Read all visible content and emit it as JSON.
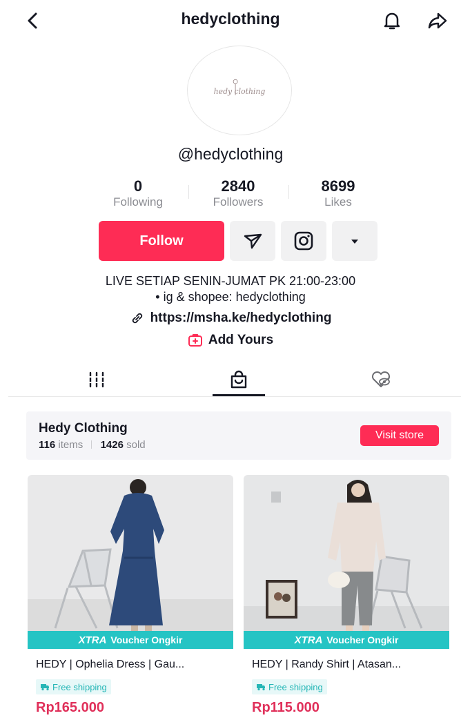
{
  "header": {
    "title": "hedyclothing",
    "back_icon": "chevron-left-icon",
    "bell_icon": "bell-icon",
    "share_icon": "share-arrow-icon"
  },
  "profile": {
    "avatar_logo_text": "hedy clothing",
    "handle": "@hedyclothing",
    "stats": [
      {
        "value": "0",
        "label": "Following"
      },
      {
        "value": "2840",
        "label": "Followers"
      },
      {
        "value": "8699",
        "label": "Likes"
      }
    ],
    "follow_label": "Follow",
    "message_icon": "send-message-icon",
    "instagram_icon": "instagram-icon",
    "more_icon": "caret-down-icon",
    "bio_line1": "LIVE SETIAP SENIN-JUMAT PK 21:00-23:00",
    "bio_line2": "• ig & shopee: hedyclothing",
    "link": "https://msha.ke/hedyclothing",
    "add_yours": "Add Yours"
  },
  "tabs": [
    {
      "name": "videos",
      "icon": "grid-icon",
      "active": false
    },
    {
      "name": "shop",
      "icon": "shopping-bag-icon",
      "active": true
    },
    {
      "name": "liked",
      "icon": "hidden-heart-icon",
      "active": false
    }
  ],
  "store": {
    "name": "Hedy Clothing",
    "items_count": "116",
    "items_label": "items",
    "sold_count": "1426",
    "sold_label": "sold",
    "visit_label": "Visit store"
  },
  "products": [
    {
      "xtra": "XTRA",
      "voucher": "Voucher Ongkir",
      "name": "HEDY | Ophelia Dress | Gau...",
      "shipping": "Free shipping",
      "price": "Rp165.000"
    },
    {
      "xtra": "XTRA",
      "voucher": "Voucher Ongkir",
      "name": "HEDY | Randy Shirt | Atasan...",
      "shipping": "Free shipping",
      "price": "Rp115.000"
    }
  ],
  "colors": {
    "accent": "#fe2c55",
    "teal": "#25c4c4",
    "text": "#161823",
    "muted": "#8a8b91"
  }
}
